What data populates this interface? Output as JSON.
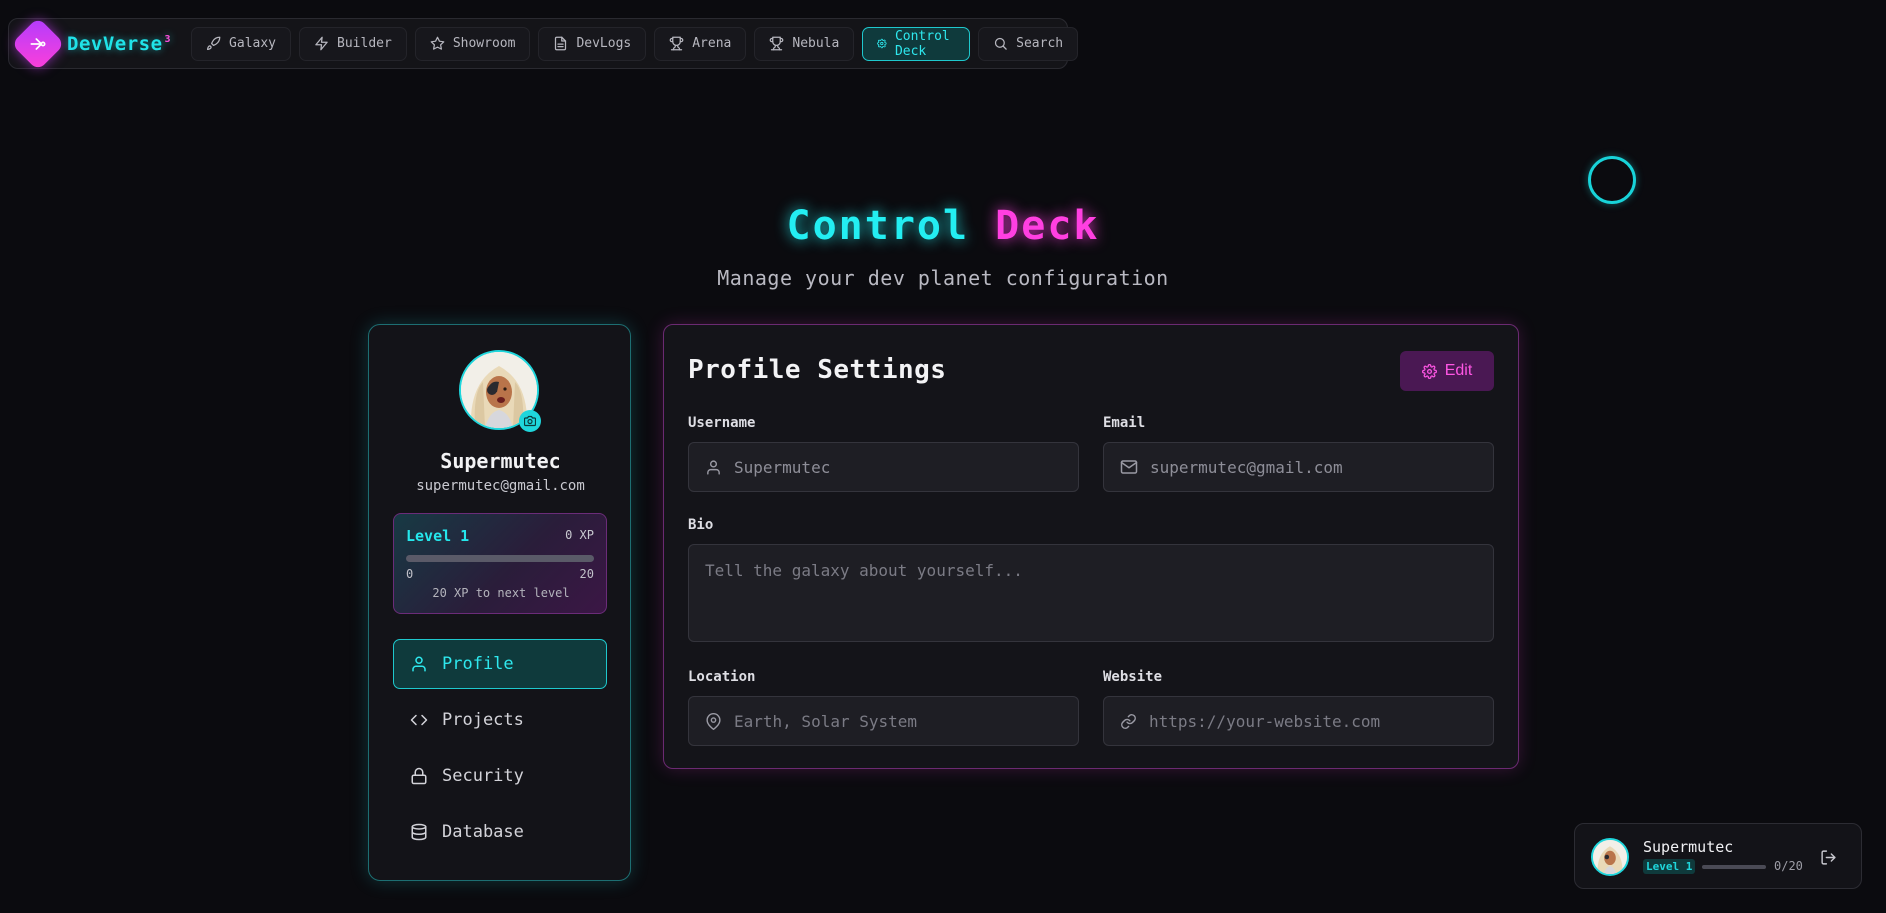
{
  "brand": {
    "name": "DevVerse",
    "superscript": "3"
  },
  "nav": [
    {
      "label": "Galaxy",
      "icon": "rocket-icon"
    },
    {
      "label": "Builder",
      "icon": "bolt-icon"
    },
    {
      "label": "Showroom",
      "icon": "star-icon"
    },
    {
      "label": "DevLogs",
      "icon": "document-icon"
    },
    {
      "label": "Arena",
      "icon": "trophy-icon"
    },
    {
      "label": "Nebula",
      "icon": "trophy-icon"
    },
    {
      "label": "Control Deck",
      "icon": "gear-icon",
      "active": true
    },
    {
      "label": "Search",
      "icon": "search-icon"
    }
  ],
  "hero": {
    "title_part1": "Control",
    "title_part2": "Deck",
    "subtitle": "Manage your dev planet configuration"
  },
  "profile": {
    "username": "Supermutec",
    "email": "supermutec@gmail.com",
    "level_label": "Level 1",
    "xp_label": "0 XP",
    "xp_progress": 0,
    "range_min": "0",
    "range_max": "20",
    "next_level_text": "20 XP to next level"
  },
  "side_menu": [
    {
      "label": "Profile",
      "icon": "user-icon",
      "active": true
    },
    {
      "label": "Projects",
      "icon": "code-icon"
    },
    {
      "label": "Security",
      "icon": "lock-icon"
    },
    {
      "label": "Database",
      "icon": "database-icon"
    }
  ],
  "settings": {
    "title": "Profile Settings",
    "edit_label": "Edit",
    "username_label": "Username",
    "username_value": "Supermutec",
    "email_label": "Email",
    "email_value": "supermutec@gmail.com",
    "bio_label": "Bio",
    "bio_placeholder": "Tell the galaxy about yourself...",
    "location_label": "Location",
    "location_placeholder": "Earth, Solar System",
    "website_label": "Website",
    "website_placeholder": "https://your-website.com"
  },
  "mini_card": {
    "name": "Supermutec",
    "level": "Level 1",
    "progress_text": "0/20",
    "progress": 0
  },
  "colors": {
    "accent_cyan": "#23eef2",
    "accent_magenta": "#ff3fe1",
    "background": "#0b0b0f"
  }
}
